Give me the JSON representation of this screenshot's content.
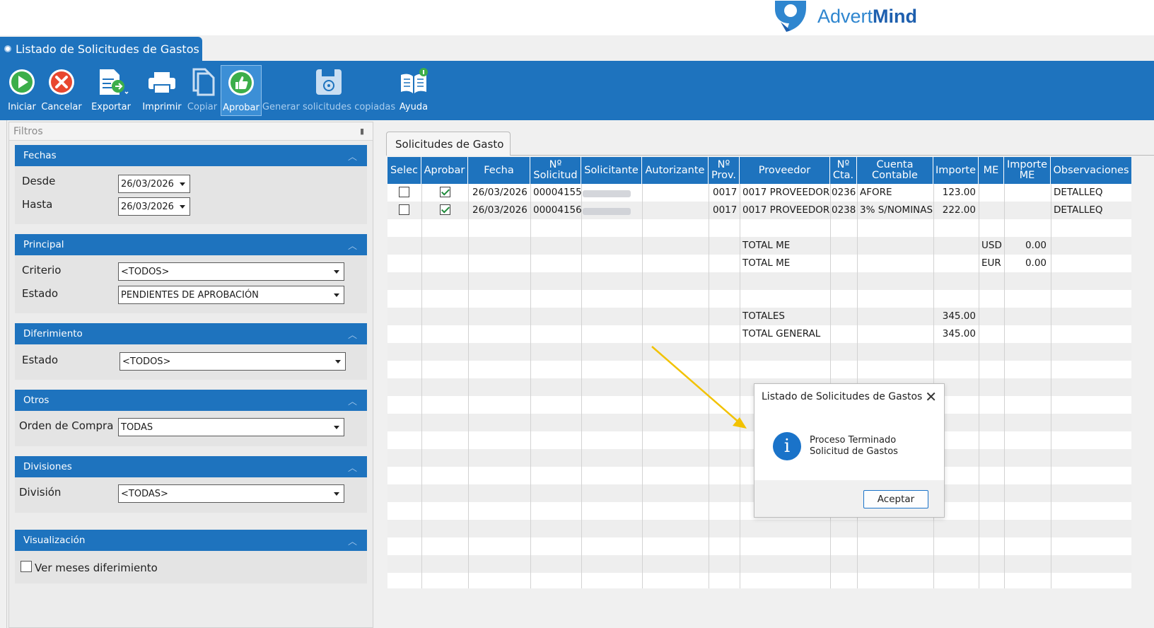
{
  "brand": {
    "name_light": "Advert",
    "name_bold": "Mind"
  },
  "window": {
    "title": "Listado de Solicitudes de Gastos"
  },
  "toolbar": {
    "iniciar": "Iniciar",
    "cancelar": "Cancelar",
    "exportar": "Exportar",
    "imprimir": "Imprimir",
    "copiar": "Copiar",
    "aprobar": "Aprobar",
    "generar": "Generar solicitudes copiadas",
    "ayuda": "Ayuda"
  },
  "filters": {
    "title": "Filtros",
    "fechas": {
      "title": "Fechas",
      "desde_label": "Desde",
      "desde_value": "26/03/2026",
      "hasta_label": "Hasta",
      "hasta_value": "26/03/2026"
    },
    "principal": {
      "title": "Principal",
      "criterio_label": "Criterio",
      "criterio_value": "<TODOS>",
      "estado_label": "Estado",
      "estado_value": "PENDIENTES DE APROBACIÓN"
    },
    "diferimiento": {
      "title": "Diferimiento",
      "estado_label": "Estado",
      "estado_value": "<TODOS>"
    },
    "otros": {
      "title": "Otros",
      "orden_label": "Orden de Compra",
      "orden_value": "TODAS"
    },
    "divisiones": {
      "title": "Divisiones",
      "division_label": "División",
      "division_value": "<TODAS>"
    },
    "visualizacion": {
      "title": "Visualización",
      "ver_meses_label": "Ver meses diferimiento",
      "ver_meses_checked": false
    }
  },
  "grid": {
    "tab": "Solicitudes de Gasto",
    "headers": {
      "selec": "Selec",
      "aprobar": "Aprobar",
      "fecha": "Fecha",
      "nsolicitud_1": "Nº",
      "nsolicitud_2": "Solicitud",
      "solicitante": "Solicitante",
      "autorizante": "Autorizante",
      "nprov_1": "Nº",
      "nprov_2": "Prov.",
      "proveedor": "Proveedor",
      "ncta_1": "Nº",
      "ncta_2": "Cta.",
      "cuenta_1": "Cuenta",
      "cuenta_2": "Contable",
      "importe": "Importe",
      "me": "ME",
      "importe_me_1": "Importe",
      "importe_me_2": "ME",
      "observaciones": "Observaciones"
    },
    "rows": [
      {
        "selected": false,
        "approve": true,
        "fecha": "26/03/2026",
        "solicitud": "00004155",
        "nprov": "0017",
        "proveedor": "0017 PROVEEDOR",
        "ncta": "0236",
        "cuenta": "AFORE",
        "importe": "123.00",
        "obs": "DETALLEQ"
      },
      {
        "selected": false,
        "approve": true,
        "fecha": "26/03/2026",
        "solicitud": "00004156",
        "nprov": "0017",
        "proveedor": "0017 PROVEEDOR",
        "ncta": "0238",
        "cuenta": "3% S/NOMINAS",
        "importe": "222.00",
        "obs": "DETALLEQ"
      }
    ],
    "totals": {
      "me_label_1": "TOTAL ME",
      "me_currency_1": "USD",
      "me_value_1": "0.00",
      "me_label_2": "TOTAL ME",
      "me_currency_2": "EUR",
      "me_value_2": "0.00",
      "totales_label": "TOTALES",
      "totales_value": "345.00",
      "general_label": "TOTAL GENERAL",
      "general_value": "345.00"
    }
  },
  "dialog": {
    "title": "Listado de Solicitudes de Gastos",
    "message_1": "Proceso Terminado",
    "message_2": "Solicitud de Gastos",
    "ok": "Aceptar"
  },
  "colors": {
    "primary": "#1e73be",
    "annotation_arrow": "#f2c200"
  }
}
